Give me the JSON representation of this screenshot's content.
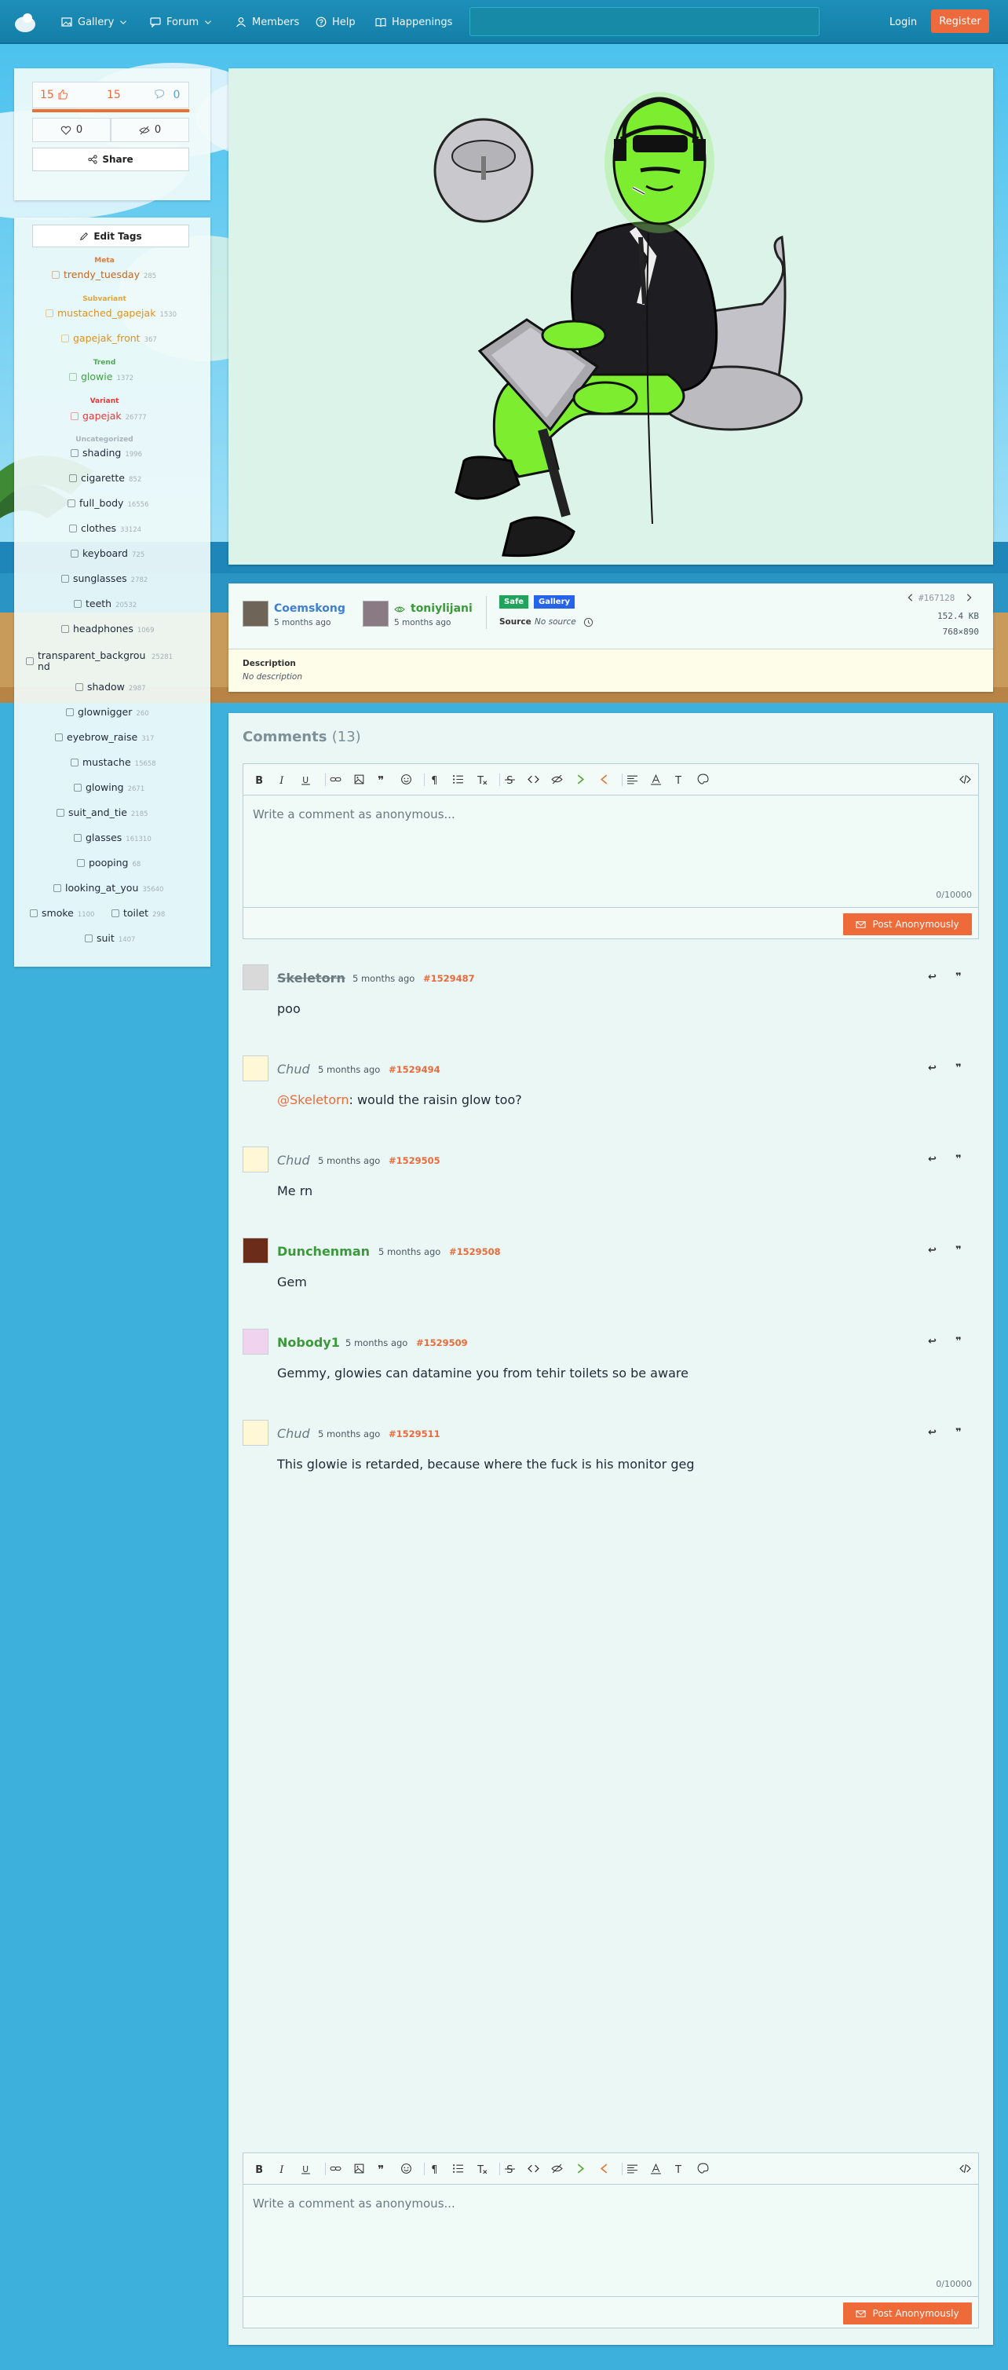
{
  "nav": {
    "items": [
      {
        "label": "Gallery",
        "icon": "image-icon",
        "has_dropdown": true
      },
      {
        "label": "Forum",
        "icon": "chat-icon",
        "has_dropdown": true
      },
      {
        "label": "Members",
        "icon": "person-icon",
        "has_dropdown": false
      },
      {
        "label": "Help",
        "icon": "help-icon",
        "has_dropdown": false
      },
      {
        "label": "Happenings",
        "icon": "book-icon",
        "has_dropdown": false
      }
    ],
    "login": "Login",
    "register": "Register"
  },
  "votes": {
    "up": "15",
    "score": "15",
    "down": "0",
    "favorites": "0",
    "hidden": "0",
    "score_fraction": 1.0
  },
  "sidebar": {
    "share_label": "Share",
    "edit_tags_label": "Edit Tags",
    "categories": {
      "meta": "Meta",
      "subvariant": "Subvariant",
      "trend": "Trend",
      "variant": "Variant",
      "uncategorized": "Uncategorized"
    },
    "tags": [
      {
        "name": "trendy_tuesday",
        "count": "285",
        "category": "meta"
      },
      {
        "name": "mustached_gapejak",
        "count": "1530",
        "category": "subvariant"
      },
      {
        "name": "gapejak_front",
        "count": "367",
        "category": "subvariant"
      },
      {
        "name": "glowie",
        "count": "1372",
        "category": "trend"
      },
      {
        "name": "gapejak",
        "count": "26777",
        "category": "variant"
      },
      {
        "name": "shading",
        "count": "1996",
        "category": "uncategorized"
      },
      {
        "name": "cigarette",
        "count": "852",
        "category": "uncategorized"
      },
      {
        "name": "full_body",
        "count": "16556",
        "category": "uncategorized"
      },
      {
        "name": "clothes",
        "count": "33124",
        "category": "uncategorized"
      },
      {
        "name": "keyboard",
        "count": "725",
        "category": "uncategorized"
      },
      {
        "name": "sunglasses",
        "count": "2782",
        "category": "uncategorized"
      },
      {
        "name": "teeth",
        "count": "20532",
        "category": "uncategorized"
      },
      {
        "name": "headphones",
        "count": "1069",
        "category": "uncategorized"
      },
      {
        "name": "transparent_background",
        "count": "25281",
        "category": "uncategorized"
      },
      {
        "name": "shadow",
        "count": "2987",
        "category": "uncategorized"
      },
      {
        "name": "glownigger",
        "count": "260",
        "category": "uncategorized"
      },
      {
        "name": "eyebrow_raise",
        "count": "317",
        "category": "uncategorized"
      },
      {
        "name": "mustache",
        "count": "15658",
        "category": "uncategorized"
      },
      {
        "name": "glowing",
        "count": "2671",
        "category": "uncategorized"
      },
      {
        "name": "suit_and_tie",
        "count": "2185",
        "category": "uncategorized"
      },
      {
        "name": "glasses",
        "count": "161310",
        "category": "uncategorized"
      },
      {
        "name": "pooping",
        "count": "68",
        "category": "uncategorized"
      },
      {
        "name": "looking_at_you",
        "count": "35640",
        "category": "uncategorized"
      },
      {
        "name": "smoke",
        "count": "1100",
        "category": "uncategorized"
      },
      {
        "name": "toilet",
        "count": "298",
        "category": "uncategorized"
      },
      {
        "name": "suit",
        "count": "1407",
        "category": "uncategorized"
      }
    ]
  },
  "image_info": {
    "uploader": "Coemskong",
    "uploader_time": "5 months ago",
    "artist": "toniylijani",
    "artist_time": "5 months ago",
    "rating_badge": "Safe",
    "gallery_badge": "Gallery",
    "source_label": "Source",
    "source_value": "No source",
    "image_id": "#167128",
    "file_size": "152.4 KB",
    "dimensions": "768×890",
    "description_label": "Description",
    "description_value": "No description"
  },
  "comments_section": {
    "title": "Comments",
    "count": "(13)",
    "placeholder": "Write a comment as anonymous...",
    "counter": "0/10000",
    "post_label": "Post Anonymously",
    "comments": [
      {
        "author": "Skeletorn",
        "time": "5 months ago",
        "id": "#1529487",
        "body": "poo",
        "style": "strike"
      },
      {
        "author": "Chud",
        "time": "5 months ago",
        "id": "#1529494",
        "mention": "@Skeletorn",
        "body": ": would the raisin glow too?",
        "style": "italic"
      },
      {
        "author": "Chud",
        "time": "5 months ago",
        "id": "#1529505",
        "body": "Me rn",
        "style": "italic"
      },
      {
        "author": "Dunchenman",
        "time": "5 months ago",
        "id": "#1529508",
        "body": "Gem",
        "style": "green"
      },
      {
        "author": "Nobody1",
        "time": "5 months ago",
        "id": "#1529509",
        "body": "Gemmy, glowies can datamine you from tehir toilets so be aware",
        "style": "green"
      },
      {
        "author": "Chud",
        "time": "5 months ago",
        "id": "#1529511",
        "body": "This glowie is retarded, because where the fuck is his monitor geg",
        "style": "italic"
      }
    ]
  },
  "colors": {
    "accent": "#ee6a3a",
    "topbar": "#1588b1",
    "page_bg": "#3db0dc",
    "panel_bg": "#ebf7f4",
    "safe": "#20a35a",
    "gallery": "#2563eb",
    "trend": "#4caf50",
    "variant": "#e53935",
    "meta": "#e07b39"
  }
}
